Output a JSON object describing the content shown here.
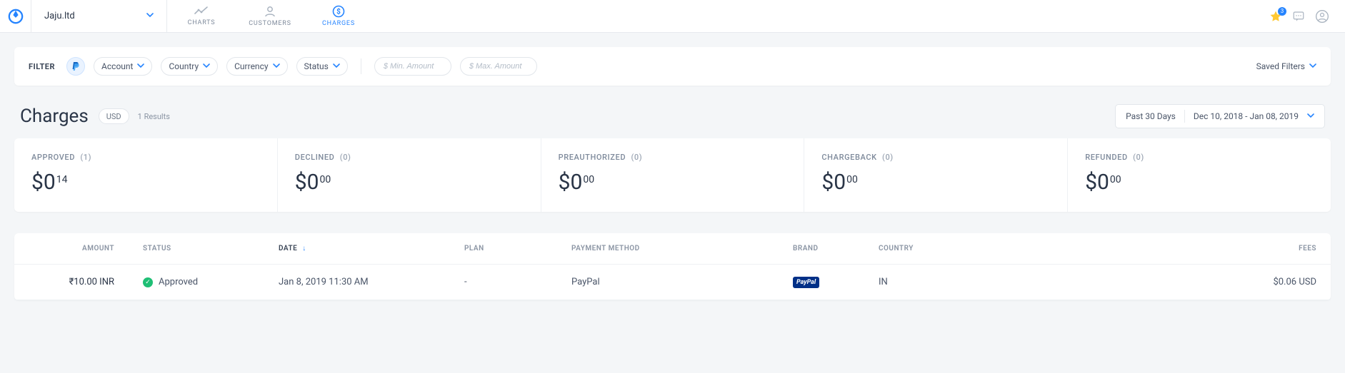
{
  "account": {
    "name": "Jaju.ltd"
  },
  "nav": {
    "tabs": [
      {
        "id": "charts",
        "label": "CHARTS",
        "active": false
      },
      {
        "id": "customers",
        "label": "CUSTOMERS",
        "active": false
      },
      {
        "id": "charges",
        "label": "CHARGES",
        "active": true
      }
    ]
  },
  "header_icons": {
    "star_badge": "3"
  },
  "filter": {
    "label": "FILTER",
    "pills": {
      "account": "Account",
      "country": "Country",
      "currency": "Currency",
      "status": "Status"
    },
    "min_placeholder": "$ Min. Amount",
    "max_placeholder": "$ Max. Amount",
    "saved_filters": "Saved Filters"
  },
  "page": {
    "title": "Charges",
    "currency": "USD",
    "results_label": "1 Results"
  },
  "date_range": {
    "preset": "Past 30 Days",
    "range": "Dec 10, 2018 - Jan 08, 2019"
  },
  "stats": {
    "approved": {
      "label": "APPROVED",
      "count": "(1)",
      "major": "$0",
      "minor": "14"
    },
    "declined": {
      "label": "DECLINED",
      "count": "(0)",
      "major": "$0",
      "minor": "00"
    },
    "preauthorized": {
      "label": "PREAUTHORIZED",
      "count": "(0)",
      "major": "$0",
      "minor": "00"
    },
    "chargeback": {
      "label": "CHARGEBACK",
      "count": "(0)",
      "major": "$0",
      "minor": "00"
    },
    "refunded": {
      "label": "REFUNDED",
      "count": "(0)",
      "major": "$0",
      "minor": "00"
    }
  },
  "table": {
    "headers": {
      "amount": "AMOUNT",
      "status": "STATUS",
      "date": "DATE",
      "plan": "PLAN",
      "payment_method": "PAYMENT METHOD",
      "brand": "BRAND",
      "country": "COUNTRY",
      "fees": "FEES"
    },
    "rows": [
      {
        "amount": "₹10.00 INR",
        "status": "Approved",
        "status_kind": "approved",
        "date": "Jan 8, 2019 11:30 AM",
        "plan": "-",
        "payment_method": "PayPal",
        "brand": "PayPal",
        "country": "IN",
        "fees": "$0.06 USD"
      }
    ]
  }
}
